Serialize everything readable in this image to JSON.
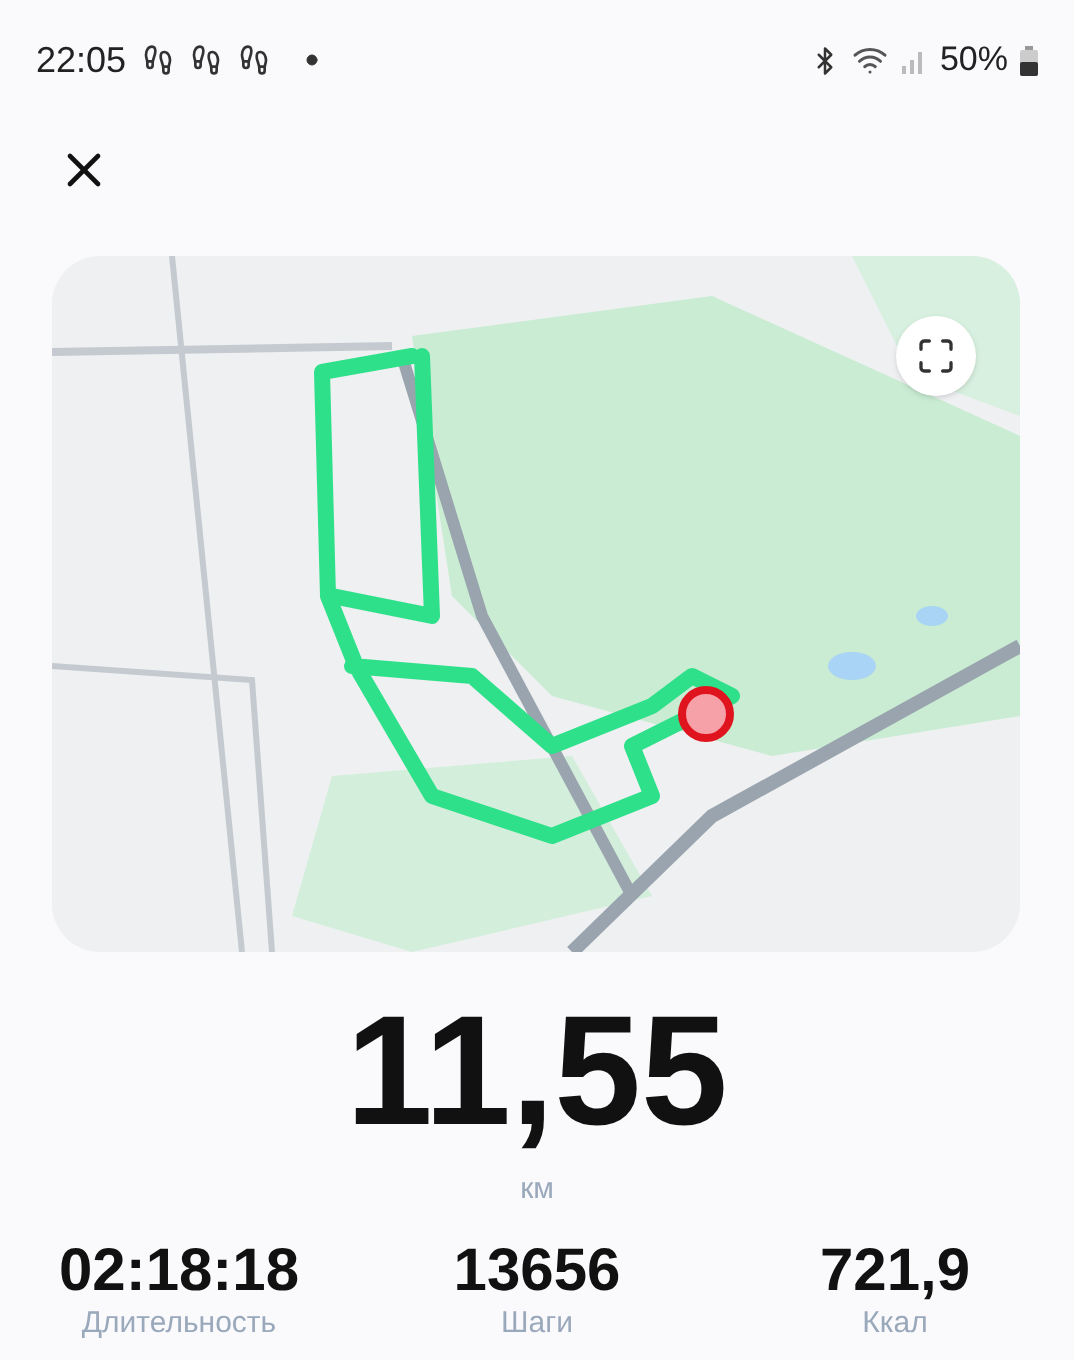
{
  "status_bar": {
    "time": "22:05",
    "battery": "50%"
  },
  "distance": {
    "value": "11,55",
    "unit": "км"
  },
  "stats": [
    {
      "value": "02:18:18",
      "label": "Длительность"
    },
    {
      "value": "13656",
      "label": "Шаги"
    },
    {
      "value": "721,9",
      "label": "Ккал"
    }
  ]
}
